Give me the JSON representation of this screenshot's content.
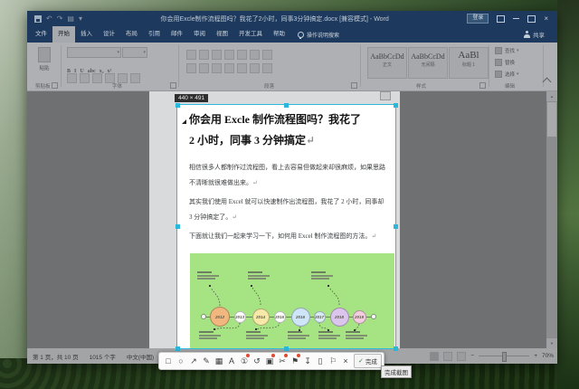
{
  "colors": {
    "accent": "#2fb9dc",
    "titlebar": "#1d3a5e",
    "badge_red": "#e2492f",
    "image_green": "#a5e383"
  },
  "icons": {
    "caret": "▾",
    "check": "✓",
    "undo": "↶",
    "redo": "↷",
    "stamp": "▤",
    "up_arrow": "▲",
    "down_arrow": "▼",
    "close": "×",
    "plus": "+",
    "minus": "−"
  },
  "titlebar": {
    "title": "你会用Excle制作流程图吗？我花了2小时，同事3分钟搞定.docx [兼容模式] - Word",
    "signin": "登录"
  },
  "ribbon": {
    "tabs": [
      {
        "label": "文件"
      },
      {
        "label": "开始",
        "active": true
      },
      {
        "label": "插入"
      },
      {
        "label": "设计"
      },
      {
        "label": "布局"
      },
      {
        "label": "引用"
      },
      {
        "label": "邮件"
      },
      {
        "label": "审阅"
      },
      {
        "label": "视图"
      },
      {
        "label": "开发工具"
      },
      {
        "label": "帮助"
      }
    ],
    "tellme": "操作说明搜索",
    "share": "共享",
    "groups": {
      "clipboard": {
        "button": "粘贴",
        "label": "剪贴板"
      },
      "font": {
        "label": "字体",
        "row1": [
          "B",
          "I",
          "U",
          "abc",
          "x₂",
          "x²"
        ],
        "row2_count": 6
      },
      "paragraph": {
        "label": "段落",
        "row1_count": 7,
        "row2_count": 7
      },
      "styles": {
        "label": "样式",
        "items": [
          {
            "sample": "AaBbCcDd",
            "name": "正文",
            "big": false
          },
          {
            "sample": "AaBbCcDd",
            "name": "无间隔",
            "big": false
          },
          {
            "sample": "AaBl",
            "name": "标题 1",
            "big": true
          }
        ]
      },
      "editing": {
        "label": "编辑",
        "items": [
          {
            "label": "查找",
            "dd": true
          },
          {
            "label": "替换",
            "dd": false
          },
          {
            "label": "选择",
            "dd": true
          }
        ]
      }
    }
  },
  "document": {
    "heading_lines": [
      "你会用 Excle 制作流程图吗？我花了",
      "2 小时，同事 3 分钟搞定↵"
    ],
    "paragraphs": [
      {
        "lines": [
          "相信很多人都制作过流程图，看上去容易但做起来却很麻烦，如果思路",
          "不清晰就很难做出来。↵"
        ]
      },
      {
        "lines": [
          "其实我们使用 Excel 就可以快速制作出流程图，我花了 2 小时，同事却",
          "3 分钟搞定了。↵"
        ]
      },
      {
        "lines": [
          "下面就让我们一起来学习一下，如何用 Excel 制作流程图的方法。↵"
        ]
      }
    ],
    "image": {
      "bg": "#a5e383",
      "timeline": [
        {
          "year": "2012",
          "color": "#f2b77e",
          "d": 22
        },
        {
          "year": "2013",
          "color": "#ffffff",
          "d": 13
        },
        {
          "year": "2014",
          "color": "#f6e8a6",
          "d": 19
        },
        {
          "year": "2015",
          "color": "#ffffff",
          "d": 13
        },
        {
          "year": "2016",
          "color": "#cde5f7",
          "d": 21
        },
        {
          "year": "2017",
          "color": "#d9eaf8",
          "d": 13
        },
        {
          "year": "2018",
          "color": "#dbc5ec",
          "d": 21
        },
        {
          "year": "2019",
          "color": "#f3cce0",
          "d": 15
        }
      ]
    }
  },
  "snip": {
    "size_label": "440 × 491",
    "tools": [
      {
        "name": "rect-tool",
        "glyph": "□",
        "badge": false
      },
      {
        "name": "ellipse-tool",
        "glyph": "○",
        "badge": false
      },
      {
        "name": "arrow-tool",
        "glyph": "↗",
        "badge": false
      },
      {
        "name": "pen-tool",
        "glyph": "✎",
        "badge": false
      },
      {
        "name": "mosaic-tool",
        "glyph": "▦",
        "badge": false
      },
      {
        "name": "text-tool",
        "glyph": "A",
        "badge": false
      },
      {
        "name": "counter-tool",
        "glyph": "①",
        "badge": true
      },
      {
        "name": "undo-tool",
        "glyph": "↺",
        "badge": false
      },
      {
        "name": "scroll-capture-tool",
        "glyph": "▣",
        "badge": true
      },
      {
        "name": "record-tool",
        "glyph": "✂",
        "badge": true
      },
      {
        "name": "pin-tool",
        "glyph": "⚑",
        "badge": true
      },
      {
        "name": "save-tool",
        "glyph": "↧",
        "badge": false
      },
      {
        "name": "device-tool",
        "glyph": "▯",
        "badge": false
      },
      {
        "name": "bookmark-tool",
        "glyph": "⚐",
        "badge": false
      },
      {
        "name": "close-tool",
        "glyph": "×",
        "badge": false
      }
    ],
    "done": "完成",
    "tooltip": "完成截图"
  },
  "statusbar": {
    "page_info": "第 1 页，共 10 页",
    "word_count": "1015 个字",
    "language": "中文(中国)",
    "zoom_label": "70%"
  }
}
